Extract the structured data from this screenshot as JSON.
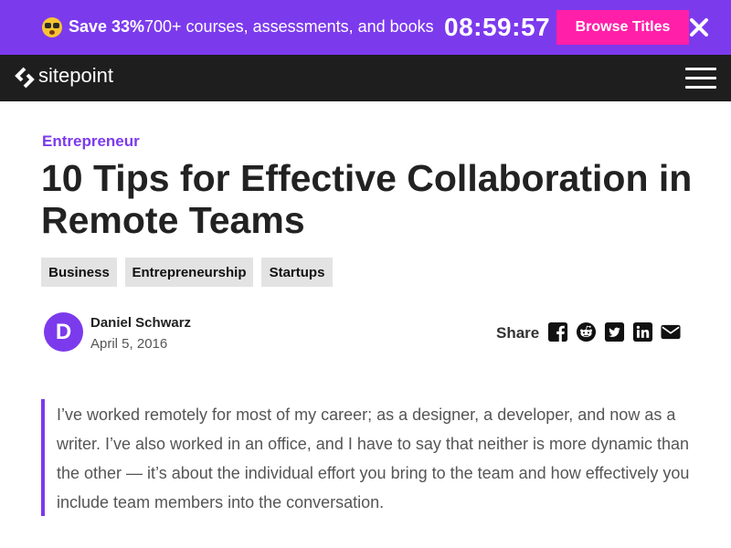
{
  "promo": {
    "emoji_icon": "shocked-face-emoji",
    "save_text": "Save 33%",
    "offer_text": "700+ courses, assessments, and books",
    "timer": "08:59:57",
    "button_label": "Browse Titles",
    "close_icon": "close-icon"
  },
  "header": {
    "logo_text": "sitepoint",
    "menu_icon": "hamburger-menu-icon"
  },
  "article": {
    "category": "Entrepreneur",
    "title": "10 Tips for Effective Collaboration in Remote Teams",
    "tags": [
      "Business",
      "Entrepreneurship",
      "Startups"
    ],
    "author": {
      "initial": "D",
      "name": "Daniel Schwarz",
      "date": "April 5, 2016"
    },
    "share": {
      "label": "Share",
      "icons": [
        "facebook-icon",
        "reddit-icon",
        "twitter-icon",
        "linkedin-icon",
        "email-icon"
      ]
    },
    "intro": "I’ve worked remotely for most of my career; as a designer, a developer, and now as a writer. I’ve also worked in an office, and I have to say that neither is more dynamic than the other — it’s about the individual effort you bring to the team and how effectively you include team members into the conversation."
  },
  "colors": {
    "accent": "#7c3aed",
    "promo_button": "#ff1fa8",
    "header_bg": "#1e1e1e",
    "tag_bg": "#e3e3e3"
  }
}
